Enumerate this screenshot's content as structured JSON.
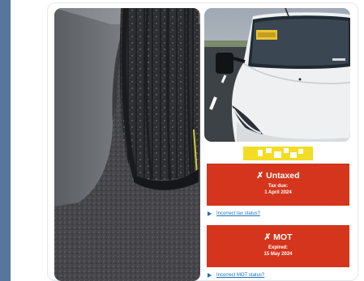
{
  "tax_status": {
    "title": "✗ Untaxed",
    "due_label": "Tax due:",
    "due_date": "1 April 2024",
    "link": "Incorrect tax status?"
  },
  "mot_status": {
    "title": "✗ MOT",
    "expired_label": "Expired:",
    "expired_date": "15 May 2024",
    "link": "Incorrect MOT status?"
  },
  "colors": {
    "status_red": "#d4351c",
    "link_blue": "#1d70b8",
    "plate_yellow": "#f3dd22",
    "sidebar": "#56769a"
  }
}
